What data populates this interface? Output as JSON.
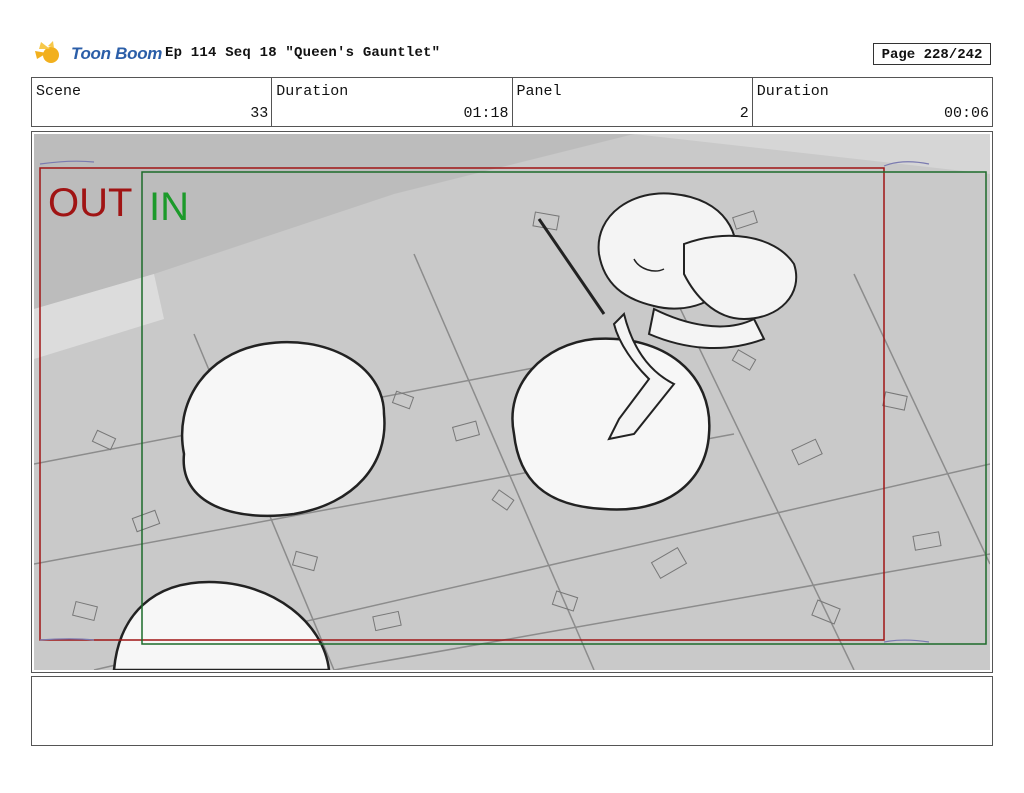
{
  "header": {
    "logo_text": "Toon Boom",
    "title": "Ep 114 Seq 18 \"Queen's Gauntlet\"",
    "page": "Page 228/242"
  },
  "info": [
    {
      "label": "Scene",
      "value": "33"
    },
    {
      "label": "Duration",
      "value": "01:18"
    },
    {
      "label": "Panel",
      "value": "2"
    },
    {
      "label": "Duration",
      "value": "00:06"
    }
  ],
  "panel": {
    "out_label": "OUT",
    "in_label": "IN",
    "colors": {
      "out": "#a01414",
      "in": "#1c9a2a",
      "background": "#c9c9c9"
    }
  },
  "notes": {
    "text": ""
  }
}
